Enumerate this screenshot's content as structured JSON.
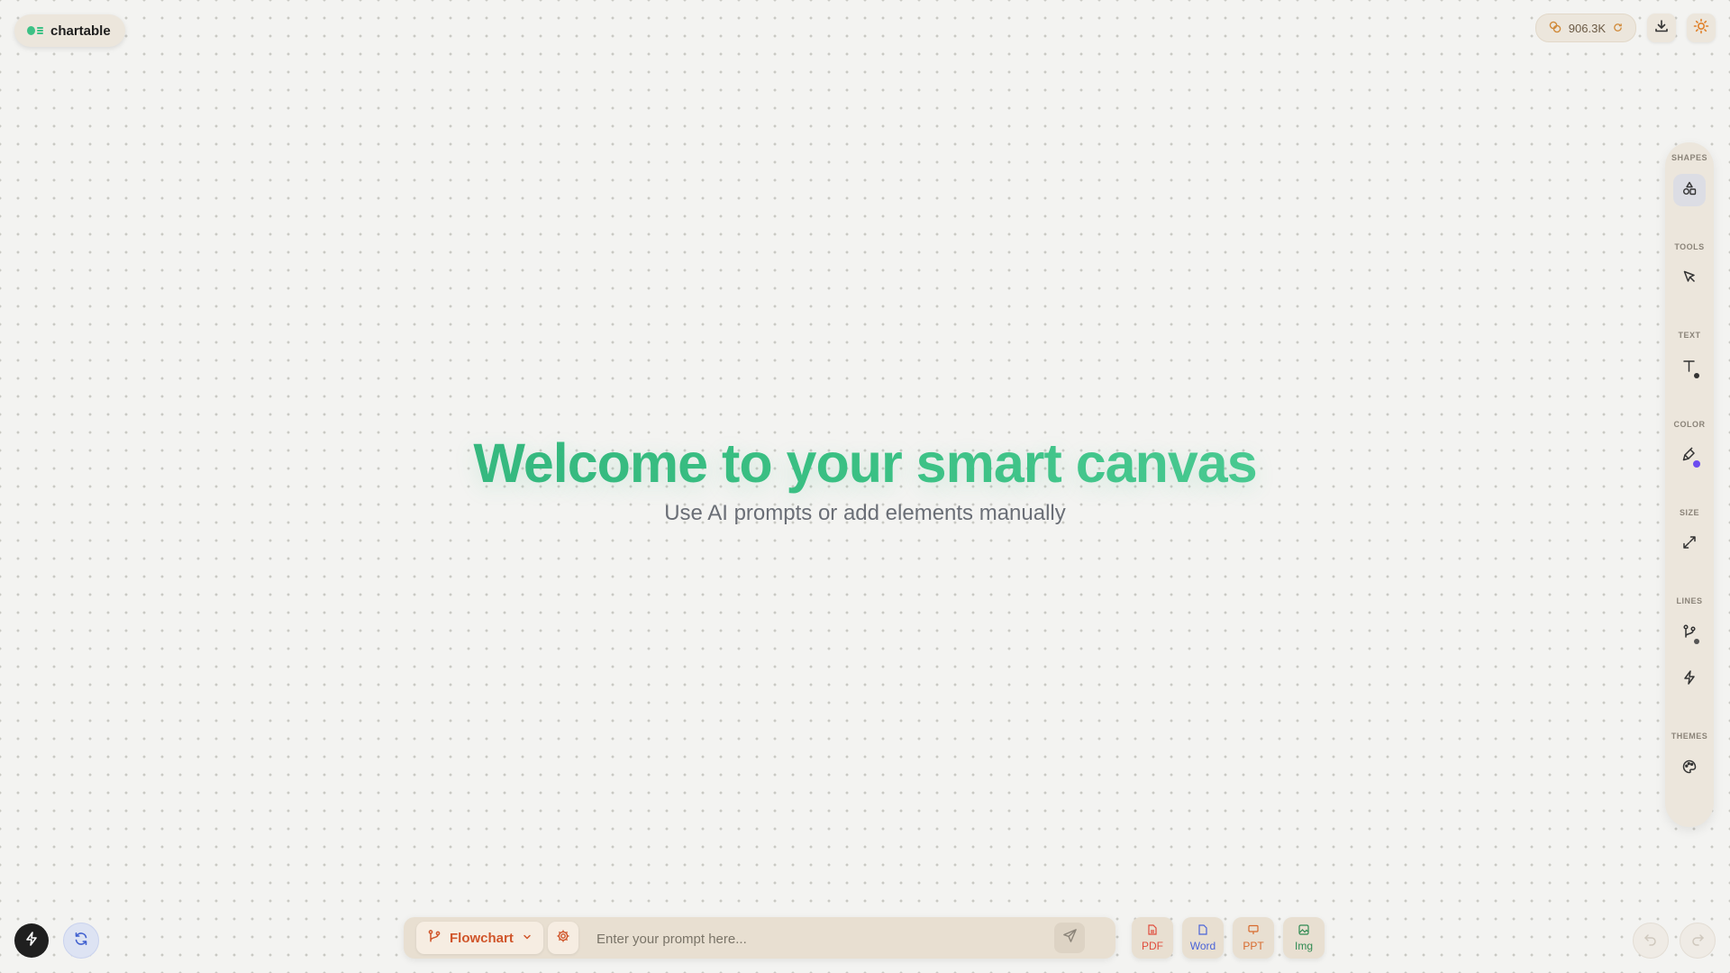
{
  "brand": {
    "name": "chartable"
  },
  "header": {
    "credits": "906.3K"
  },
  "hero": {
    "title": "Welcome to your smart canvas",
    "subtitle": "Use AI prompts or add elements manually"
  },
  "toolbar": {
    "sections": [
      {
        "label": "SHAPES",
        "icon": "shapes-icon"
      },
      {
        "label": "TOOLS",
        "icon": "pointer-icon"
      },
      {
        "label": "TEXT",
        "icon": "text-icon"
      },
      {
        "label": "COLOR",
        "icon": "paint-icon",
        "accent": "#6c4cf0"
      },
      {
        "label": "SIZE",
        "icon": "resize-icon"
      },
      {
        "label": "LINES",
        "icon": "connector-icon"
      },
      {
        "label": "THEMES",
        "icon": "palette-icon"
      }
    ]
  },
  "prompt": {
    "mode_label": "Flowchart",
    "placeholder": "Enter your prompt here..."
  },
  "export": {
    "pdf": "PDF",
    "word": "Word",
    "ppt": "PPT",
    "img": "Img"
  },
  "colors": {
    "brand_green": "#3cc185",
    "accent_orange": "#d0552a",
    "pdf": "#e04c3c",
    "word": "#4a63d8",
    "ppt": "#d86a2c",
    "img": "#2f8a52"
  }
}
